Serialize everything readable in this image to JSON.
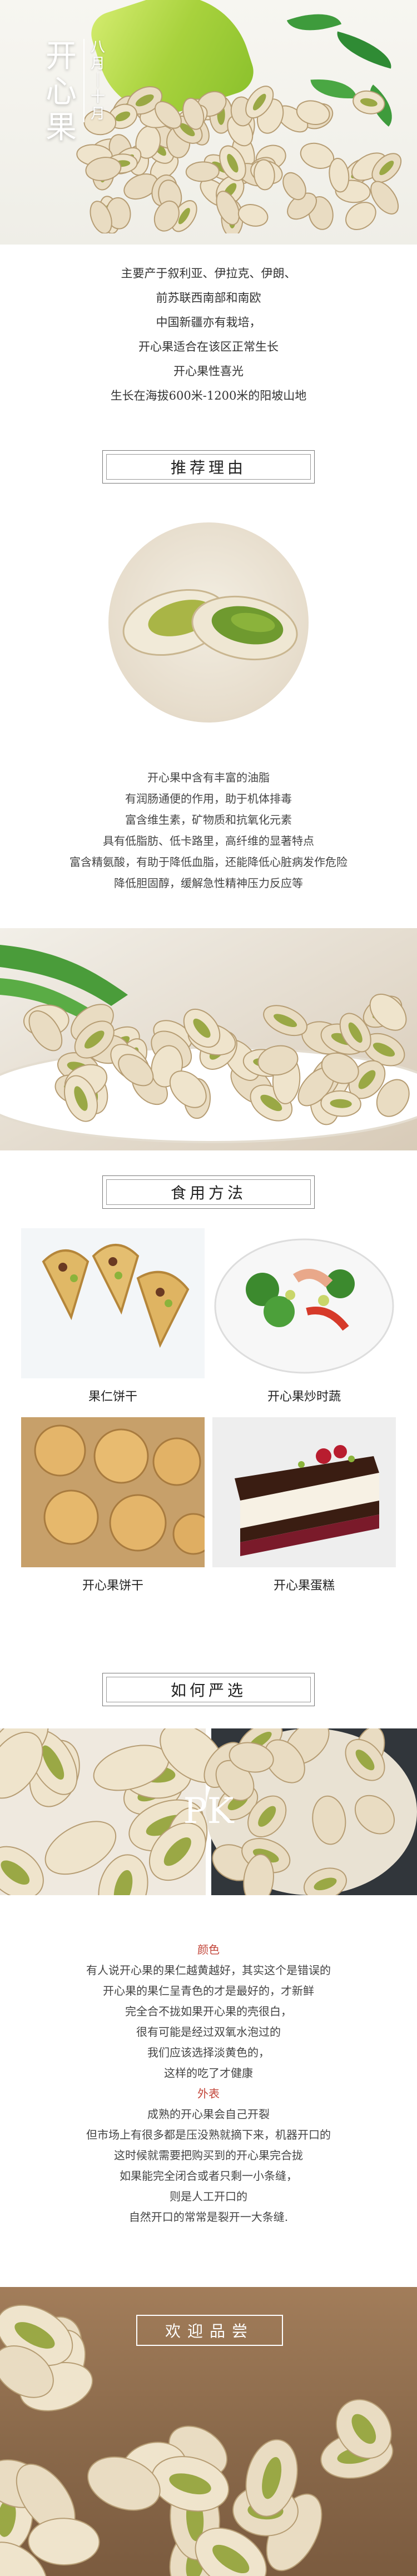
{
  "hero": {
    "title_main": "开心果",
    "title_side": "八月｜十月"
  },
  "intro": {
    "lines": [
      "主要产于叙利亚、伊拉克、伊朗、",
      "前苏联西南部和南欧",
      "中国新疆亦有栽培，",
      "开心果适合在该区正常生长",
      "开心果性喜光",
      "生长在海拔600米-1200米的阳坡山地"
    ]
  },
  "reason": {
    "heading": "推荐理由",
    "lines": [
      "开心果中含有丰富的油脂",
      "有润肠通便的作用，助于机体排毒",
      "富含维生素，矿物质和抗氧化元素",
      "具有低脂肪、低卡路里，高纤维的显著特点",
      "富含精氨酸，有助于降低血脂，还能降低心脏病发作危险",
      "降低胆固醇，缓解急性精神压力反应等"
    ]
  },
  "usage": {
    "heading": "食用方法",
    "items": [
      {
        "label": "果仁饼干"
      },
      {
        "label": "开心果炒时蔬"
      },
      {
        "label": "开心果饼干"
      },
      {
        "label": "开心果蛋糕"
      }
    ]
  },
  "select": {
    "heading": "如何严选",
    "image_text": "PK",
    "color_title": "颜色",
    "color_lines": [
      "有人说开心果的果仁越黄越好，其实这个是错误的",
      "开心果的果仁呈青色的才是最好的，才新鲜",
      "完全合不拢如果开心果的壳很白，",
      "很有可能是经过双氧水泡过的",
      "我们应该选择淡黄色的，",
      "这样的吃了才健康"
    ],
    "shape_title": "外表",
    "shape_lines": [
      "成熟的开心果会自己开裂",
      "但市场上有很多都是压没熟就摘下来，机器开口的",
      "这时候就需要把购买到的开心果完合拢",
      "如果能完全闭合或者只剩一小条缝，",
      "则是人工开口的",
      "自然开口的常常是裂开一大条缝."
    ]
  },
  "footer": {
    "welcome": "欢迎品尝"
  },
  "colors": {
    "accent_red": "#c3473b",
    "pot_green": "#a8d23d",
    "leaf_green": "#3e9b3c"
  }
}
